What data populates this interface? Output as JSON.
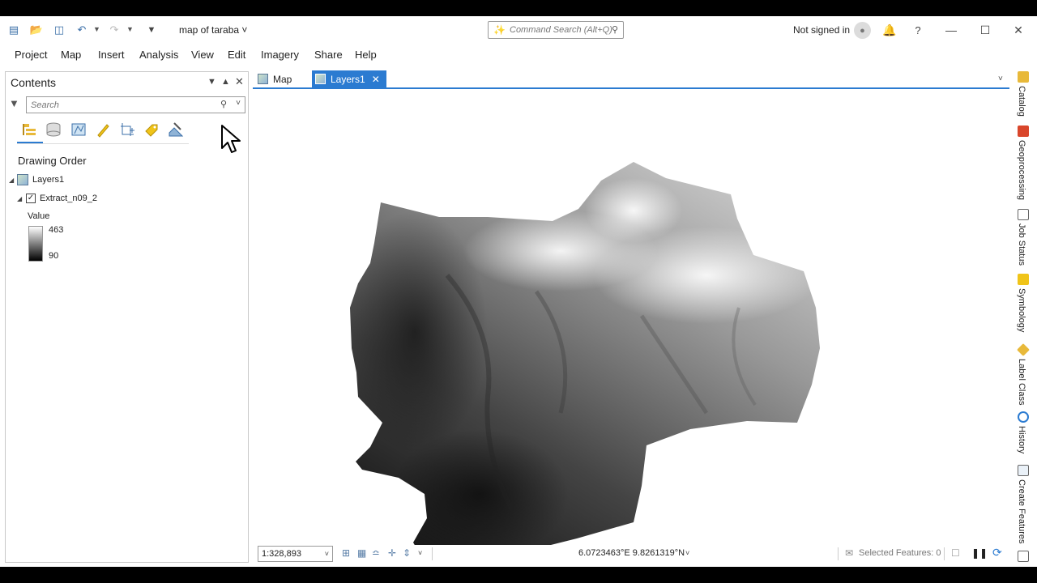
{
  "title_bar": {
    "document_title": "map of taraba",
    "command_search_placeholder": "Command Search (Alt+Q)",
    "signin_text": "Not signed in",
    "help_glyph": "?"
  },
  "menu": {
    "items": [
      "Project",
      "Map",
      "Insert",
      "Analysis",
      "View",
      "Edit",
      "Imagery",
      "Share",
      "Help"
    ]
  },
  "contents": {
    "title": "Contents",
    "search_placeholder": "Search",
    "section_heading": "Drawing Order",
    "map_name": "Layers1",
    "layer_name": "Extract_n09_2",
    "legend_label": "Value",
    "legend_high": "463",
    "legend_low": "90"
  },
  "map_tabs": [
    {
      "label": "Map",
      "active": false
    },
    {
      "label": "Layers1",
      "active": true
    }
  ],
  "status_bar": {
    "scale": "1:328,893",
    "coordinates": "6.0723463°E 9.8261319°N",
    "selected_features": "Selected Features: 0"
  },
  "dock": {
    "items": [
      "Catalog",
      "Geoprocessing",
      "Job Status",
      "Symbology",
      "Label Class",
      "History",
      "Create Features"
    ]
  },
  "colors": {
    "accent": "#2b7bd1",
    "raster_dark": "#000000",
    "raster_light": "#ffffff"
  }
}
